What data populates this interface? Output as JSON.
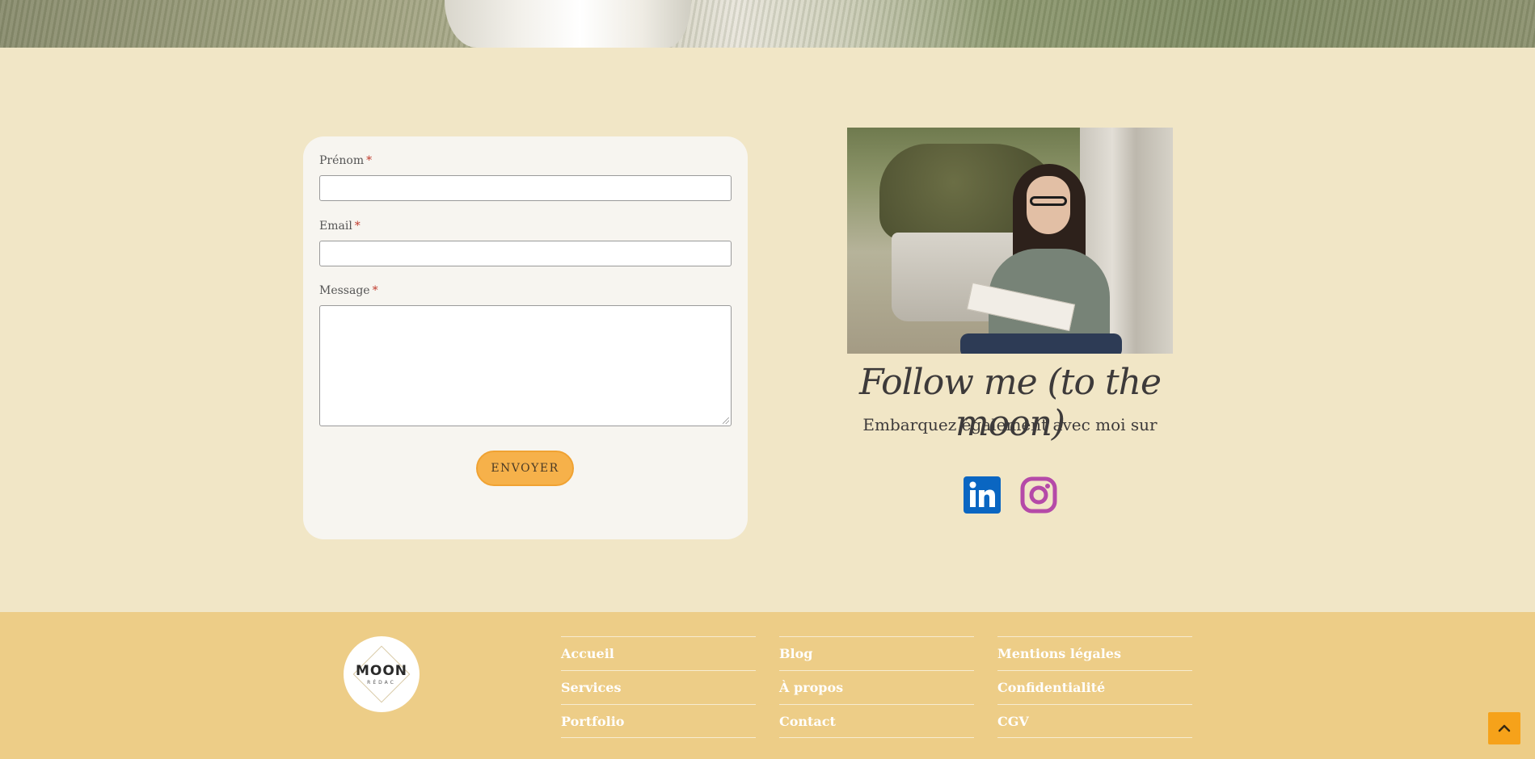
{
  "form": {
    "first_name_label": "Prénom",
    "email_label": "Email",
    "message_label": "Message",
    "required_mark": "*",
    "first_name_value": "",
    "email_value": "",
    "message_value": "",
    "submit_label": "ENVOYER"
  },
  "follow": {
    "title": "Follow me (to the moon)",
    "subtitle": "Embarquez également avec moi sur",
    "socials": [
      {
        "name": "linkedin-icon",
        "color": "#0a66c2"
      },
      {
        "name": "instagram-icon",
        "color": "#b54aa8"
      }
    ]
  },
  "footer": {
    "logo_text": "MOON",
    "logo_sub": "RÉDAC",
    "columns": [
      [
        "Accueil",
        "Services",
        "Portfolio"
      ],
      [
        "Blog",
        "À propos",
        "Contact"
      ],
      [
        "Mentions légales",
        "Confidentialité",
        "CGV"
      ]
    ]
  },
  "colors": {
    "page_bg": "#f1e6c6",
    "footer_bg": "#edcd87",
    "button": "#f6b14a",
    "back_to_top": "#f6a21a"
  },
  "back_to_top_icon": "chevron-up-icon"
}
